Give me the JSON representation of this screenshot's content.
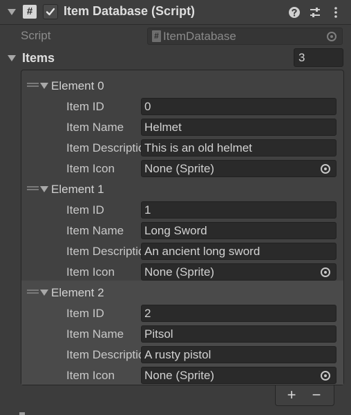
{
  "component": {
    "title": "Item Database (Script)",
    "script_icon_glyph": "#",
    "enabled": true,
    "icons": [
      "help-icon",
      "presets-icon",
      "more-options-icon"
    ]
  },
  "script_row": {
    "label": "Script",
    "value": "ItemDatabase",
    "mini_glyph": "#"
  },
  "items": {
    "label": "Items",
    "count": "3",
    "elements": [
      {
        "title": "Element 0",
        "labels": {
          "id": "Item ID",
          "name": "Item Name",
          "desc": "Item Description",
          "icon": "Item Icon"
        },
        "id": "0",
        "name": "Helmet",
        "desc": "This is an old helmet",
        "icon": "None (Sprite)"
      },
      {
        "title": "Element 1",
        "labels": {
          "id": "Item ID",
          "name": "Item Name",
          "desc": "Item Description",
          "icon": "Item Icon"
        },
        "id": "1",
        "name": "Long Sword",
        "desc": "An ancient long sword",
        "icon": "None (Sprite)"
      },
      {
        "title": "Element 2",
        "labels": {
          "id": "Item ID",
          "name": "Item Name",
          "desc": "Item Description",
          "icon": "Item Icon"
        },
        "id": "2",
        "name": "Pitsol",
        "desc": "A rusty pistol",
        "icon": "None (Sprite)"
      }
    ]
  },
  "footer": {
    "add": "+",
    "remove": "−"
  },
  "colors": {
    "background": "#3c3c3c",
    "field": "#2a2a2a",
    "text": "#d2d2d2",
    "selected_row": "#4a4a4a"
  }
}
